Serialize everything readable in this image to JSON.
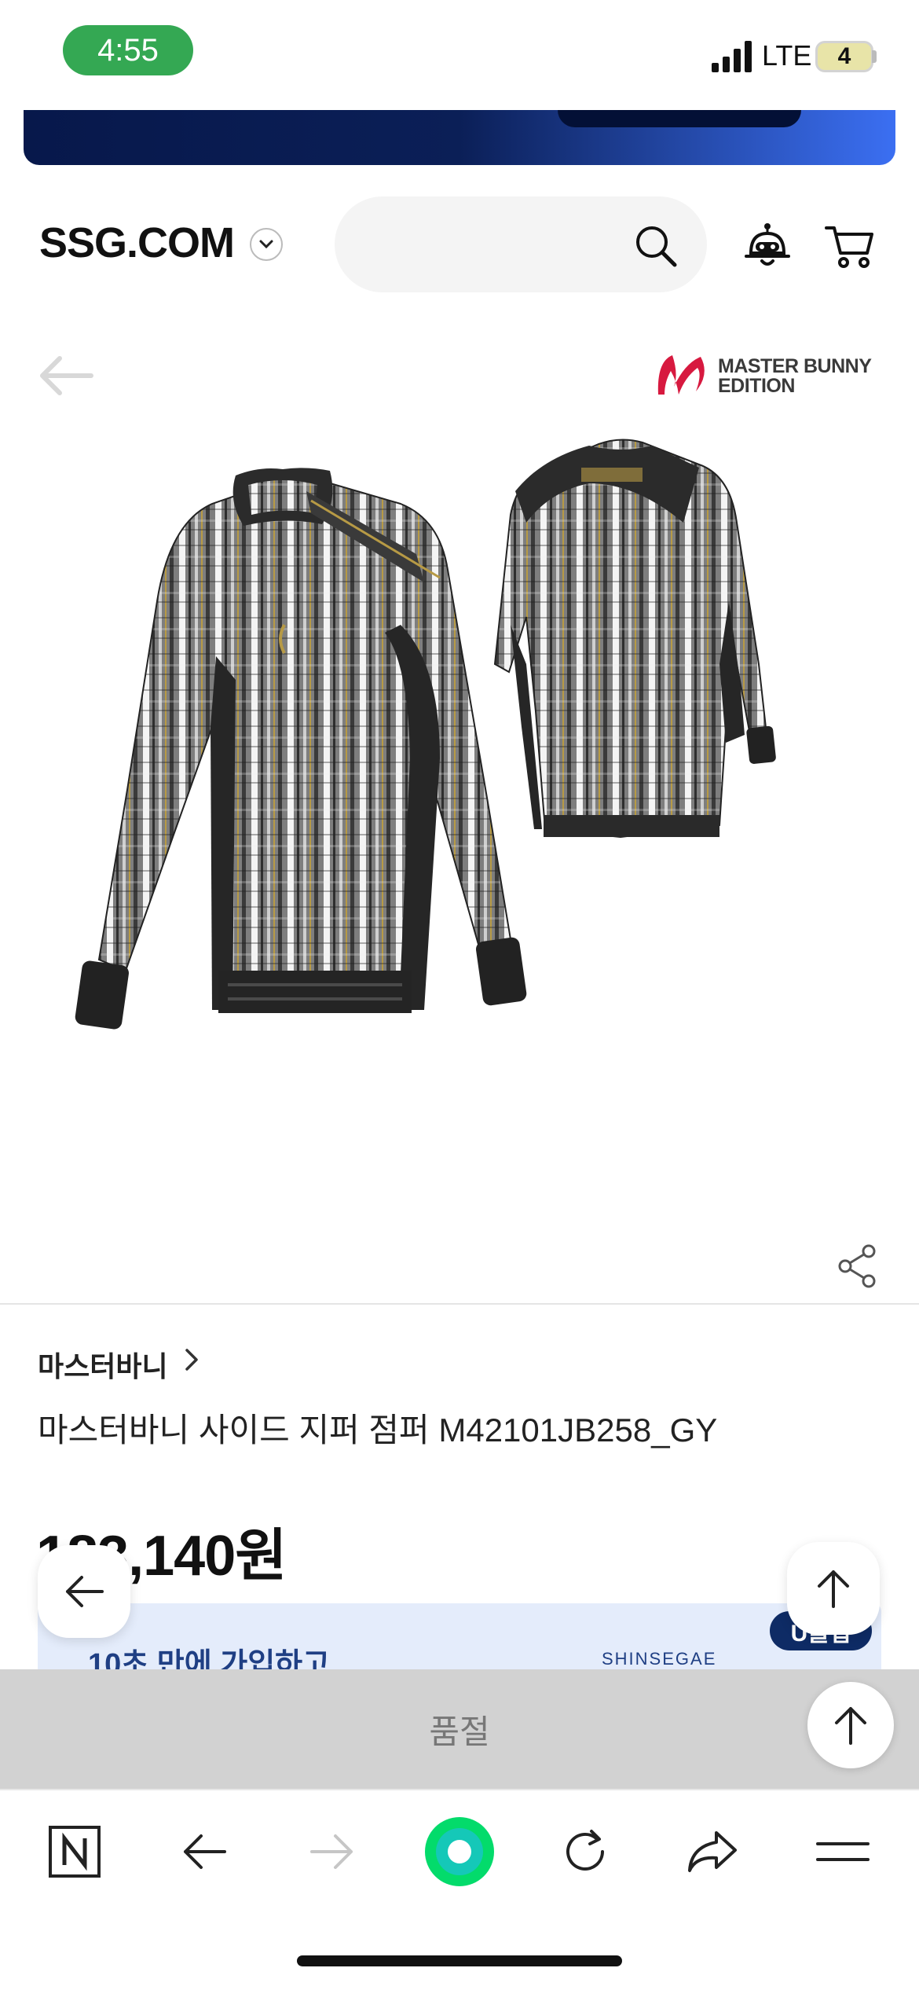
{
  "status_bar": {
    "time": "4:55",
    "network": "LTE",
    "battery": "4"
  },
  "header": {
    "logo": "SSG.COM",
    "search_placeholder": ""
  },
  "product": {
    "brand_logo_line1": "MASTER BUNNY",
    "brand_logo_line2": "EDITION",
    "brand": "마스터바니",
    "title": "마스터바니 사이드 지퍼 점퍼 M42101JB258_GY",
    "price": "183,140원"
  },
  "promo": {
    "text": "10초 만에 가입하고",
    "brand": "SHINSEGAE",
    "badge": "U클럽"
  },
  "soldout": {
    "label": "품절"
  },
  "colors": {
    "accent_green": "#34a853",
    "banner_navy": "#07184b",
    "banner_blue": "#3b6ff2",
    "soldout_bg": "#d2d2d2",
    "brand_red": "#d7193f"
  }
}
